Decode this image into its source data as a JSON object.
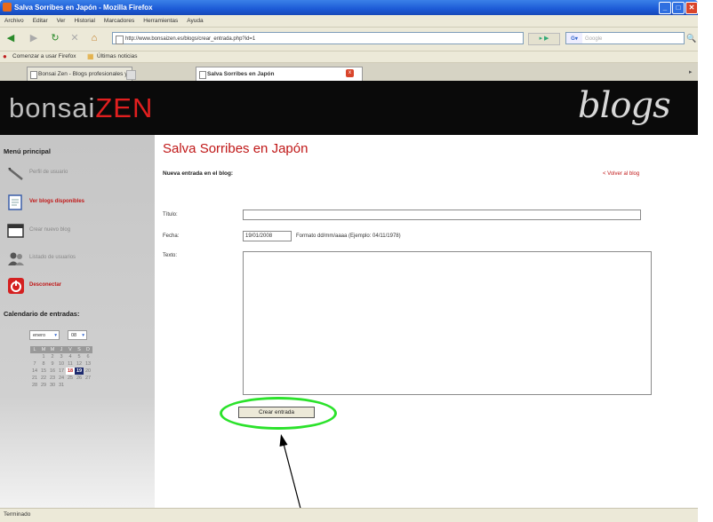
{
  "window": {
    "title": "Salva Sorribes en Japón - Mozilla Firefox",
    "minimize_glyph": "_",
    "maximize_glyph": "□",
    "close_glyph": "✕"
  },
  "menu": [
    "Archivo",
    "Editar",
    "Ver",
    "Historial",
    "Marcadores",
    "Herramientas",
    "Ayuda"
  ],
  "nav": {
    "back_glyph": "◀",
    "forward_glyph": "▶",
    "reload_glyph": "↻",
    "stop_glyph": "✕",
    "home_glyph": "⌂",
    "url": "http://www.bonsaizen.es/blogs/crear_entrada.php?id=1",
    "go_glyph": "▸ ▶",
    "search_engine": "G▾",
    "search_placeholder": "Google",
    "search_go_glyph": "🔍"
  },
  "bookmarks": {
    "item1": "Comenzar a usar Firefox",
    "item2": "Últimas noticias"
  },
  "tabs": {
    "tab1": "Bonsai Zen - Blogs profesionales y afic...",
    "tab2": "Salva Sorribes en Japón",
    "close_glyph": "x",
    "scroll_glyph": "▸"
  },
  "banner": {
    "logo_part1": "bonsai",
    "logo_part2": "ZEN",
    "right_word": "blogs"
  },
  "sidebar": {
    "menu_title": "Menú principal",
    "items": [
      {
        "label": "Perfil de usuario",
        "active": false
      },
      {
        "label": "Ver blogs disponibles",
        "active": true
      },
      {
        "label": "Crear nuevo blog",
        "active": false
      },
      {
        "label": "Listado de usuarios",
        "active": false
      },
      {
        "label": "Desconectar",
        "active": true
      }
    ],
    "calendar_title": "Calendario de entradas:",
    "calendar_month": "enero",
    "calendar_year": "08",
    "calendar_days_header": [
      "L",
      "M",
      "M",
      "J",
      "V",
      "S",
      "D"
    ],
    "calendar_weeks": [
      [
        "",
        "1",
        "2",
        "3",
        "4",
        "5",
        "6"
      ],
      [
        "7",
        "8",
        "9",
        "10",
        "11",
        "12",
        "13"
      ],
      [
        "14",
        "15",
        "16",
        "17",
        "18",
        "19",
        "20"
      ],
      [
        "21",
        "22",
        "23",
        "24",
        "25",
        "26",
        "27"
      ],
      [
        "28",
        "29",
        "30",
        "31",
        "",
        "",
        ""
      ]
    ],
    "calendar_today": "18",
    "calendar_selected": "19"
  },
  "main": {
    "title": "Salva Sorribes en Japón",
    "subtitle": "Nueva entrada en el blog:",
    "back_link": "< Volver al blog",
    "label_titulo": "Título:",
    "label_fecha": "Fecha:",
    "label_texto": "Texto:",
    "titulo_value": "",
    "fecha_value": "19/01/2008",
    "fecha_hint": "Formato dd/mm/aaaa (Ejemplo: 04/11/1978)",
    "texto_value": "",
    "create_button": "Crear entrada"
  },
  "status": "Terminado",
  "colors": {
    "accent_red": "#c01818",
    "highlight_green": "#2be22b"
  }
}
